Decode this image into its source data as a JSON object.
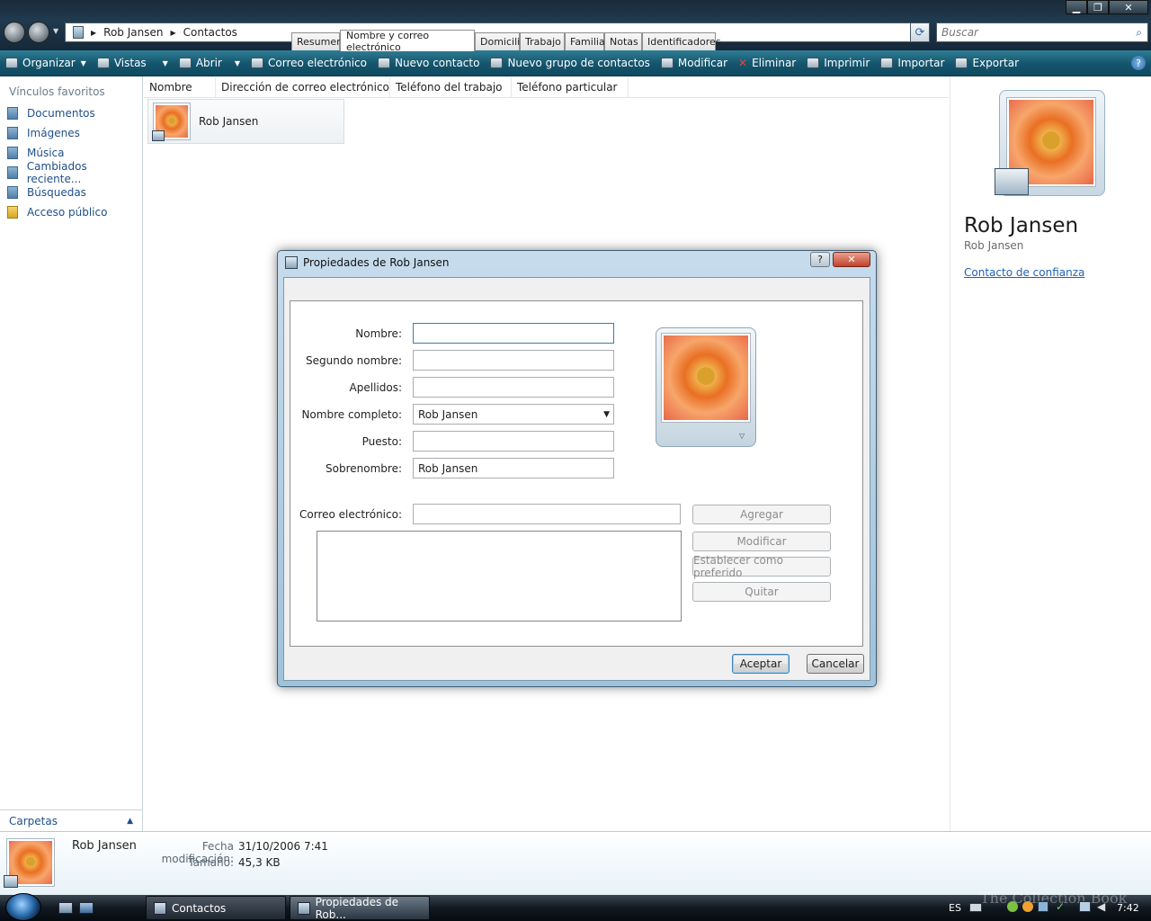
{
  "window": {
    "breadcrumb": [
      "Rob Jansen",
      "Contactos"
    ],
    "search_placeholder": "Buscar",
    "controls": {
      "minimize": "▁",
      "maximize": "❐",
      "close": "✕"
    }
  },
  "toolbar": {
    "organize": "Organizar",
    "views": "Vistas",
    "open": "Abrir",
    "email": "Correo electrónico",
    "new_contact": "Nuevo contacto",
    "new_group": "Nuevo grupo de contactos",
    "edit": "Modificar",
    "delete": "Eliminar",
    "print": "Imprimir",
    "import": "Importar",
    "export": "Exportar",
    "help": "?"
  },
  "sidebar": {
    "heading": "Vínculos favoritos",
    "items": [
      {
        "label": "Documentos"
      },
      {
        "label": "Imágenes"
      },
      {
        "label": "Música"
      },
      {
        "label": "Cambiados reciente..."
      },
      {
        "label": "Búsquedas"
      },
      {
        "label": "Acceso público"
      }
    ],
    "folders": "Carpetas"
  },
  "list": {
    "columns": [
      "Nombre",
      "Dirección de correo electrónico",
      "Teléfono del trabajo",
      "Teléfono particular"
    ],
    "items": [
      {
        "name": "Rob Jansen"
      }
    ]
  },
  "preview": {
    "name": "Rob Jansen",
    "subname": "Rob Jansen",
    "link": "Contacto de confianza"
  },
  "details": {
    "name": "Rob Jansen",
    "modified_label": "Fecha modificación:",
    "modified_value": "31/10/2006 7:41",
    "size_label": "Tamaño:",
    "size_value": "45,3 KB"
  },
  "dialog": {
    "title": "Propiedades de Rob Jansen",
    "help": "?",
    "close": "✕",
    "tabs": [
      "Resumen",
      "Nombre y correo electrónico",
      "Domicilio",
      "Trabajo",
      "Familia",
      "Notas",
      "Identificadores"
    ],
    "active_tab": "Nombre y correo electrónico",
    "fields": {
      "first_label": "Nombre:",
      "first_value": "",
      "middle_label": "Segundo nombre:",
      "middle_value": "",
      "last_label": "Apellidos:",
      "last_value": "",
      "full_label": "Nombre completo:",
      "full_value": "Rob Jansen",
      "title_label": "Puesto:",
      "title_value": "",
      "nick_label": "Sobrenombre:",
      "nick_value": "Rob Jansen",
      "email_label": "Correo electrónico:",
      "email_value": ""
    },
    "buttons": {
      "add": "Agregar",
      "modify": "Modificar",
      "preferred": "Establecer como preferido",
      "remove": "Quitar",
      "ok": "Aceptar",
      "cancel": "Cancelar"
    }
  },
  "taskbar": {
    "tasks": [
      "Contactos",
      "Propiedades de Rob..."
    ],
    "lang": "ES",
    "clock": "7:42",
    "watermark": "The Collection Book"
  }
}
